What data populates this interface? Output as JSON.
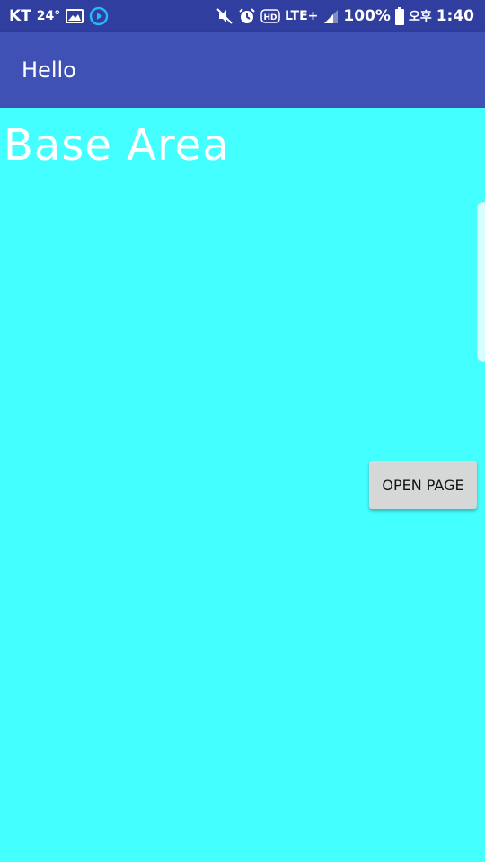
{
  "status_bar": {
    "carrier": "KT",
    "temperature": "24°",
    "icons_left": [
      "image-icon",
      "play-circle-icon"
    ],
    "icons_right": [
      "mute-icon",
      "alarm-icon",
      "hd-icon",
      "signal-icon"
    ],
    "network": "LTE+",
    "battery": "100%",
    "ampm": "오후",
    "time": "1:40"
  },
  "app_bar": {
    "title": "Hello"
  },
  "content": {
    "base_label": "Base Area",
    "open_button_label": "OPEN PAGE"
  },
  "colors": {
    "status_bar": "#303F9F",
    "app_bar": "#3F51B5",
    "background": "#44FFFF",
    "button": "#D6D7D7"
  }
}
